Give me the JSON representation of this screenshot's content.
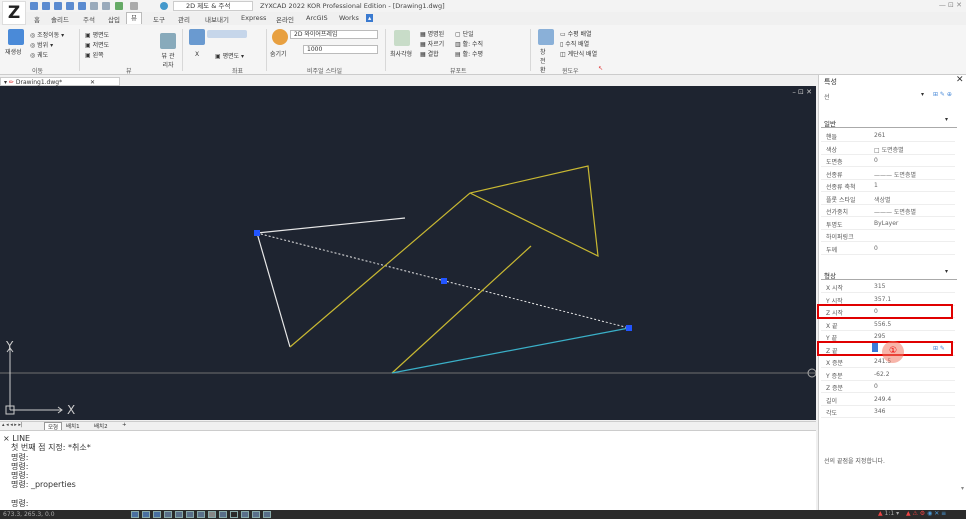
{
  "app": {
    "logo_text": "Z",
    "workspace": "2D 제도 & 주석",
    "title": "ZYXCAD 2022 KOR Professional Edition - [Drawing1.dwg]",
    "window_controls": "— ⊡ ✕"
  },
  "menu_tabs": [
    "홈",
    "솔리드",
    "주석",
    "삽입",
    "뷰",
    "도구",
    "관리",
    "내보내기",
    "Express",
    "온라인",
    "ArcGIS",
    "Works"
  ],
  "ribbon": {
    "regen": "재생성",
    "zoom": "조정이동 ▾",
    "range": "범위 ▾",
    "pan": "궤도",
    "top_view": "평면도",
    "front_view": "저면도",
    "left_view": "왼쪽",
    "views_label": "뷰 관리자",
    "ucs_x": "X",
    "plan": "평면도 ▾",
    "hide": "숨기기",
    "visual_style": "2D 와이어프레임",
    "opacity": "1000",
    "named_views": "명명된",
    "split": "자르기",
    "merge": "결합",
    "single": "단일",
    "hsplit": "활: 수직",
    "vsplit": "활: 수평",
    "vp_label": "최사각형",
    "switch": "창 전환",
    "tile_h": "수평 배열",
    "tile_v": "수직 배열",
    "cascade": "계단식 배열",
    "groups": [
      "이동",
      "뷰",
      "좌표",
      "비주얼 스타일",
      "뷰포트",
      "윈도우"
    ]
  },
  "doc_tab": "Drawing1.dwg*",
  "viewport": {
    "ctl": "– ⊡ ✕",
    "axis_y": "Y",
    "axis_x": "X"
  },
  "layout_tabs": [
    "모형",
    "배치1",
    "배치2",
    "+"
  ],
  "command_history": [
    "× LINE",
    "첫 번째 점 지정: *취소*",
    "명령:",
    "명령:",
    "명령:",
    "명령: _properties",
    "",
    "명령:"
  ],
  "status": {
    "coords": "673.3, 265.3, 0.0",
    "zoom": "1:1 ▾"
  },
  "properties": {
    "title": "특성",
    "close": "✕",
    "selection": "선",
    "general_header": "일반",
    "general": [
      {
        "label": "핸들",
        "value": "261"
      },
      {
        "label": "색상",
        "value": "□ 도면층별"
      },
      {
        "label": "도면층",
        "value": "0"
      },
      {
        "label": "선종류",
        "value": "——— 도면층별"
      },
      {
        "label": "선종류 축척",
        "value": "1"
      },
      {
        "label": "플롯 스타일",
        "value": "색상별"
      },
      {
        "label": "선가중치",
        "value": "——— 도면층별"
      },
      {
        "label": "투명도",
        "value": "ByLayer"
      },
      {
        "label": "하이퍼링크",
        "value": ""
      },
      {
        "label": "두께",
        "value": "0"
      }
    ],
    "geometry_header": "형상",
    "geometry": [
      {
        "label": "X 시작",
        "value": "315"
      },
      {
        "label": "Y 시작",
        "value": "357.1"
      },
      {
        "label": "Z 시작",
        "value": "0"
      },
      {
        "label": "X 끝",
        "value": "556.5"
      },
      {
        "label": "Y 끝",
        "value": "295"
      },
      {
        "label": "Z 끝",
        "value": "0"
      },
      {
        "label": "X 증분",
        "value": "241.5"
      },
      {
        "label": "Y 증분",
        "value": "-62.2"
      },
      {
        "label": "Z 증분",
        "value": "0"
      },
      {
        "label": "길이",
        "value": "249.4"
      },
      {
        "label": "각도",
        "value": "346"
      }
    ],
    "callout": "①",
    "description": "선의 끝점을 지정합니다."
  },
  "colors": {
    "viewport_bg": "#1e2430",
    "line_white": "#e8e8e8",
    "line_yellow": "#c8b832",
    "line_cyan": "#3ab0c8",
    "grip": "#2255ff",
    "highlight": "#e00000"
  }
}
